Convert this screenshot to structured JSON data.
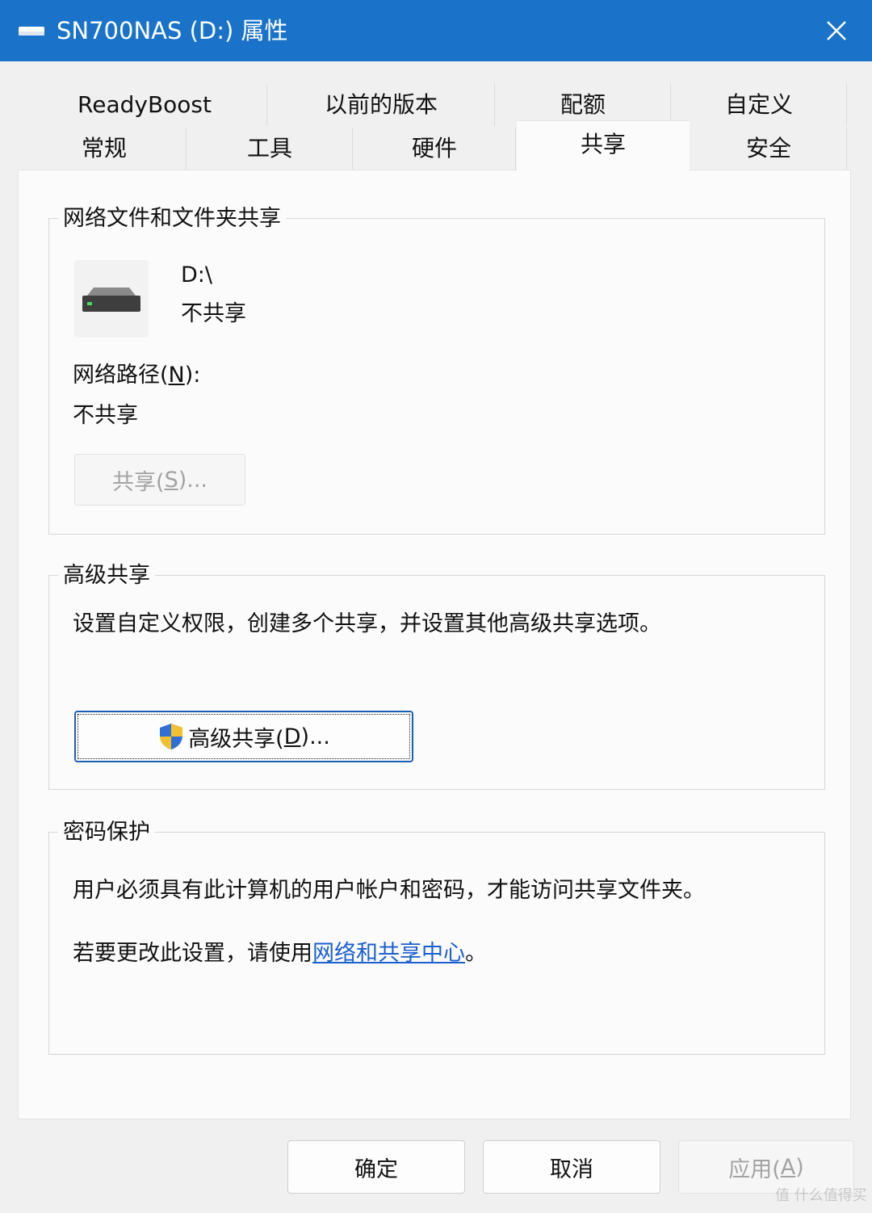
{
  "window": {
    "title": "SN700NAS (D:) 属性",
    "close_icon": "close-icon"
  },
  "tabs": {
    "row1": [
      "ReadyBoost",
      "以前的版本",
      "配额",
      "自定义"
    ],
    "row2": [
      "常规",
      "工具",
      "硬件",
      "共享",
      "安全"
    ],
    "active": "共享"
  },
  "network_sharing": {
    "label": "网络文件和文件夹共享",
    "drive_name": "D:\\",
    "drive_status": "不共享",
    "path_label_pre": "网络路径(",
    "path_label_key": "N",
    "path_label_post": "):",
    "path_value": "不共享",
    "share_button_pre": "共享(",
    "share_button_key": "S",
    "share_button_post": ")..."
  },
  "advanced_sharing": {
    "label": "高级共享",
    "description": "设置自定义权限，创建多个共享，并设置其他高级共享选项。",
    "button_pre": "高级共享(",
    "button_key": "D",
    "button_post": ")...",
    "button_icon": "uac-shield-icon"
  },
  "password_protection": {
    "label": "密码保护",
    "line1": "用户必须具有此计算机的用户帐户和密码，才能访问共享文件夹。",
    "line2_pre": "若要更改此设置，请使用",
    "line2_link": "网络和共享中心",
    "line2_post": "。"
  },
  "footer": {
    "ok": "确定",
    "cancel": "取消",
    "apply_pre": "应用(",
    "apply_key": "A",
    "apply_post": ")"
  },
  "watermark": "值 什么值得买",
  "colors": {
    "titlebar": "#1a73c9",
    "link": "#1a5fd0",
    "focus_border": "#1a5fb4"
  }
}
